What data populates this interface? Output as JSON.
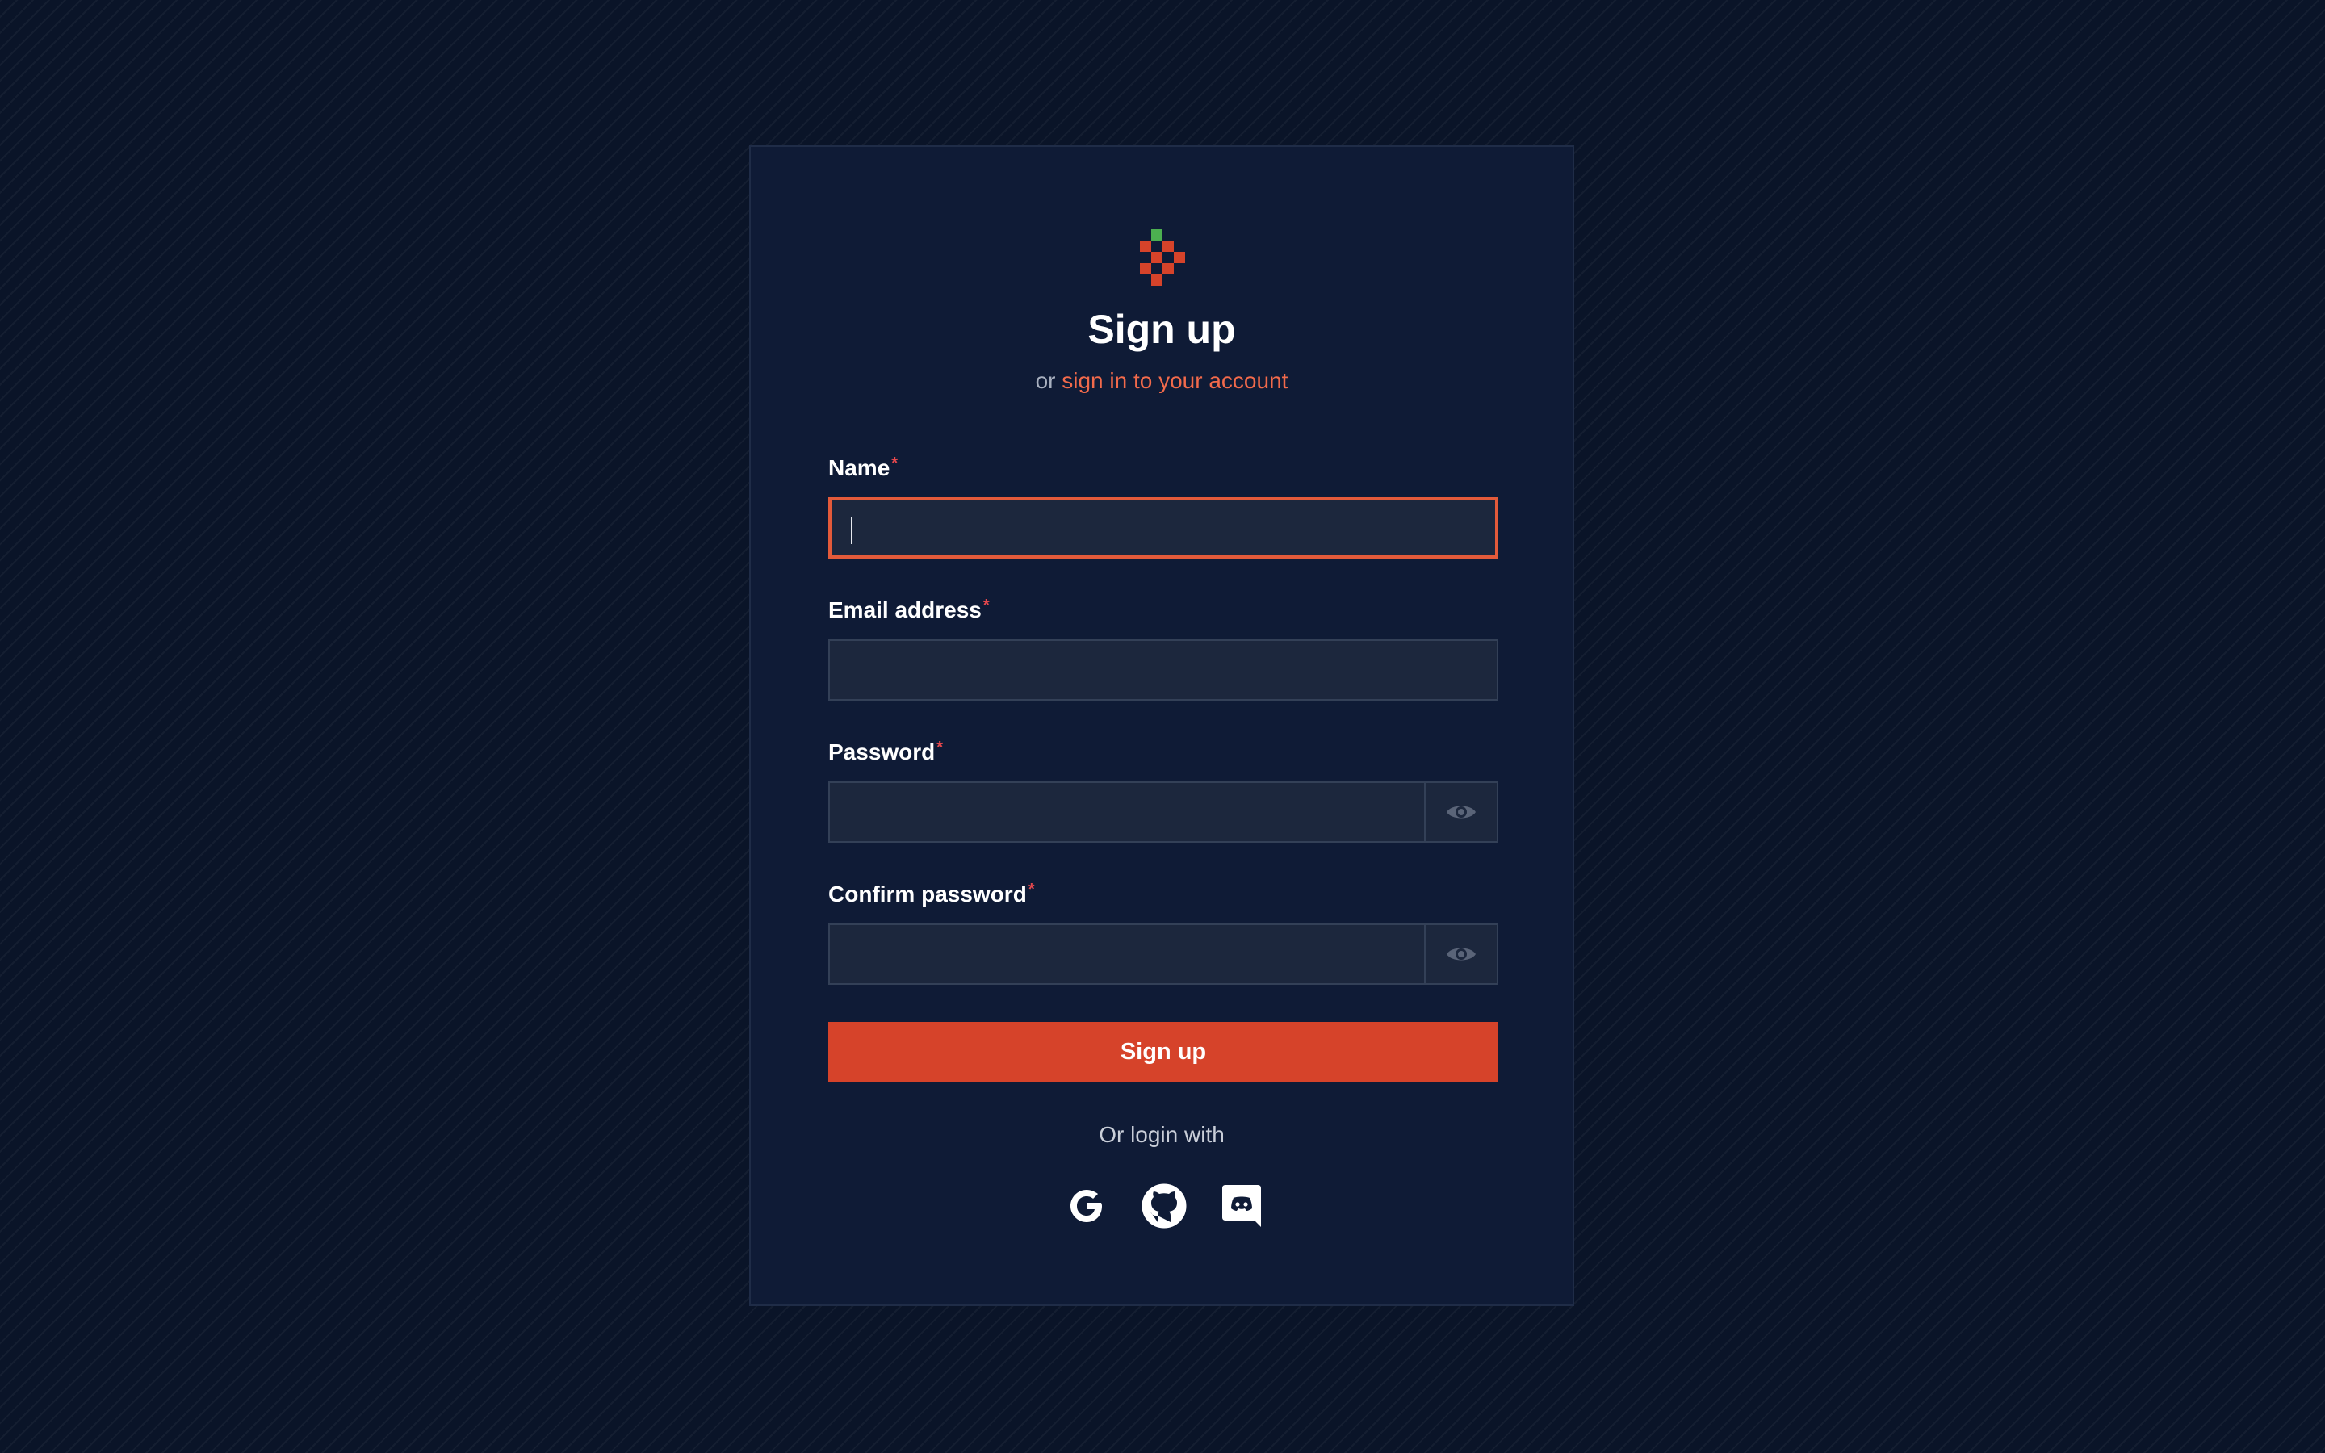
{
  "form": {
    "title": "Sign up",
    "subtitle_prefix": "or",
    "subtitle_link": "sign in to your account",
    "fields": [
      {
        "label": "Name",
        "required_mark": "*",
        "value": ""
      },
      {
        "label": "Email address",
        "required_mark": "*",
        "value": ""
      },
      {
        "label": "Password",
        "required_mark": "*",
        "value": ""
      },
      {
        "label": "Confirm password",
        "required_mark": "*",
        "value": ""
      }
    ],
    "submit_label": "Sign up",
    "alt_login_label": "Or login with",
    "social_providers": [
      "google-icon",
      "github-icon",
      "discord-icon"
    ]
  },
  "colors": {
    "accent": "#d6432a",
    "link": "#f26a4b",
    "focus_border": "#e35a3a",
    "required": "#e5484d",
    "card_bg": "#0f1b36",
    "page_bg": "#0a1428"
  }
}
